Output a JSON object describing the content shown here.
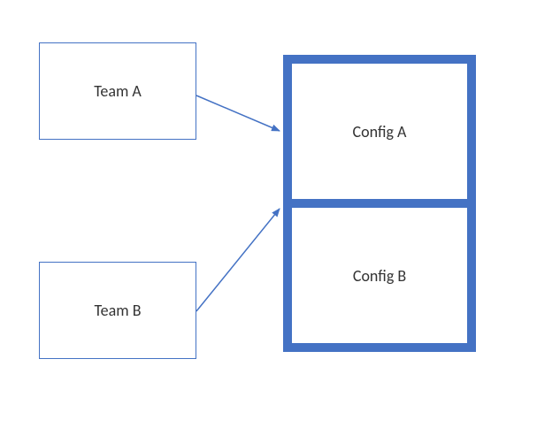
{
  "teamA": {
    "label": "Team A"
  },
  "teamB": {
    "label": "Team B"
  },
  "configA": {
    "label": "Config A"
  },
  "configB": {
    "label": "Config B"
  },
  "colors": {
    "accent": "#4472C4"
  },
  "chart_data": {
    "type": "diagram",
    "nodes": [
      {
        "id": "teamA",
        "label": "Team A"
      },
      {
        "id": "teamB",
        "label": "Team B"
      },
      {
        "id": "configA",
        "label": "Config A",
        "group": "config-container"
      },
      {
        "id": "configB",
        "label": "Config B",
        "group": "config-container"
      }
    ],
    "edges": [
      {
        "from": "teamA",
        "to": "configA"
      },
      {
        "from": "teamB",
        "to": "configA"
      }
    ]
  }
}
